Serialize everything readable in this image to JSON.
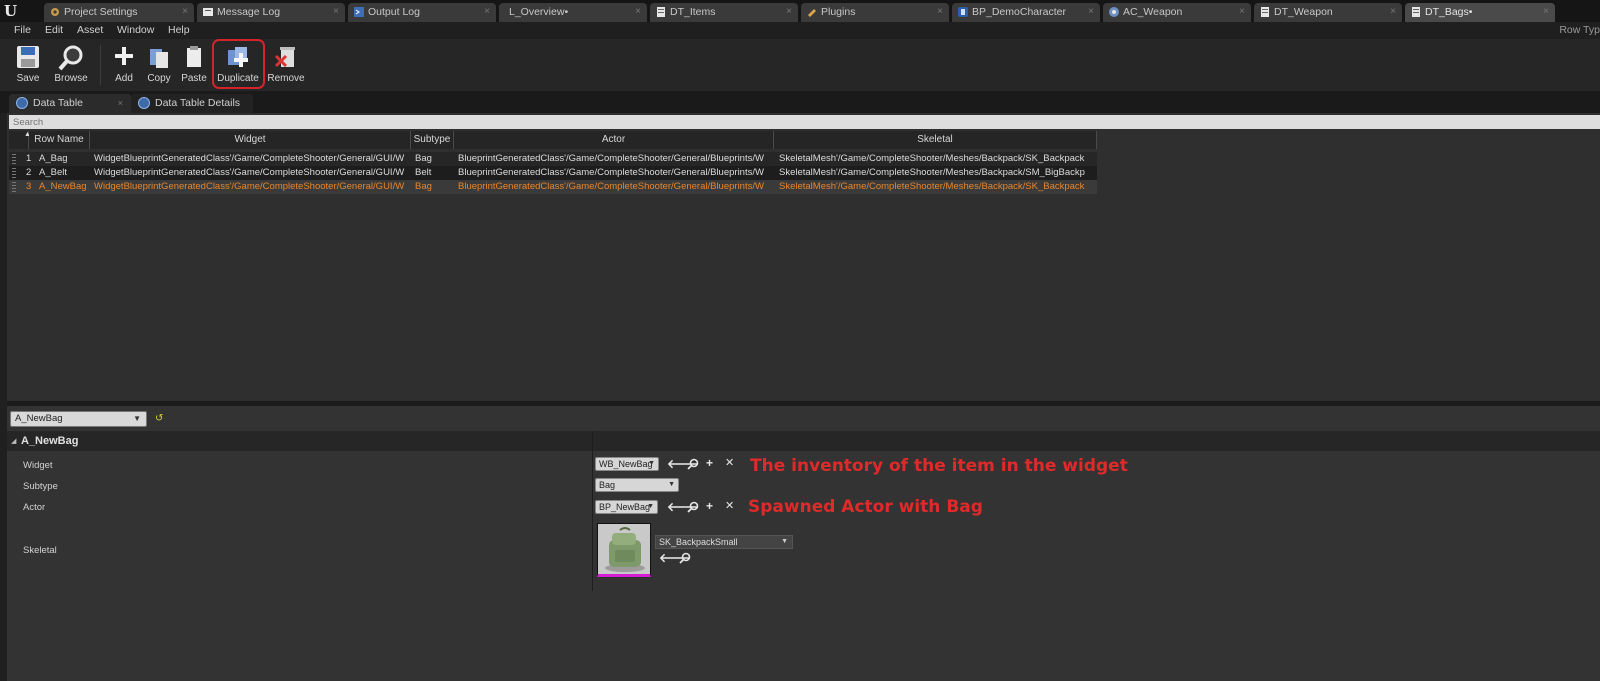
{
  "tabs": [
    {
      "label": "Project Settings",
      "icon": "settings-icon"
    },
    {
      "label": "Message Log",
      "icon": "message-log-icon"
    },
    {
      "label": "Output Log",
      "icon": "output-log-icon"
    },
    {
      "label": "L_Overview•",
      "icon": ""
    },
    {
      "label": "DT_Items",
      "icon": "data-table-icon"
    },
    {
      "label": "Plugins",
      "icon": "plugins-icon"
    },
    {
      "label": "BP_DemoCharacter",
      "icon": "blueprint-icon"
    },
    {
      "label": "AC_Weapon",
      "icon": "actor-component-icon"
    },
    {
      "label": "DT_Weapon",
      "icon": "data-table-icon"
    },
    {
      "label": "DT_Bags•",
      "icon": "data-table-icon"
    }
  ],
  "menu": [
    "File",
    "Edit",
    "Asset",
    "Window",
    "Help"
  ],
  "row_type_label": "Row Typ",
  "toolbar": {
    "save": "Save",
    "browse": "Browse",
    "add": "Add",
    "copy": "Copy",
    "paste": "Paste",
    "duplicate": "Duplicate",
    "remove": "Remove"
  },
  "panel_tabs": [
    "Data Table",
    "Data Table Details"
  ],
  "search": {
    "placeholder": "Search"
  },
  "table": {
    "columns": [
      "Row Name",
      "Widget",
      "Subtype",
      "Actor",
      "Skeletal"
    ],
    "rows": [
      {
        "index": "1",
        "name": "A_Bag",
        "widget": "WidgetBlueprintGeneratedClass'/Game/CompleteShooter/General/GUI/W",
        "subtype": "Bag",
        "actor": "BlueprintGeneratedClass'/Game/CompleteShooter/General/Blueprints/W",
        "skeletal": "SkeletalMesh'/Game/CompleteShooter/Meshes/Backpack/SK_Backpack"
      },
      {
        "index": "2",
        "name": "A_Belt",
        "widget": "WidgetBlueprintGeneratedClass'/Game/CompleteShooter/General/GUI/W",
        "subtype": "Belt",
        "actor": "BlueprintGeneratedClass'/Game/CompleteShooter/General/Blueprints/W",
        "skeletal": "SkeletalMesh'/Game/CompleteShooter/Meshes/Backpack/SM_BigBackp"
      },
      {
        "index": "3",
        "name": "A_NewBag",
        "widget": "WidgetBlueprintGeneratedClass'/Game/CompleteShooter/General/GUI/W",
        "subtype": "Bag",
        "actor": "BlueprintGeneratedClass'/Game/CompleteShooter/General/Blueprints/W",
        "skeletal": "SkeletalMesh'/Game/CompleteShooter/Meshes/Backpack/SK_Backpack"
      }
    ],
    "selected_index": 2,
    "selected_color": "#e8862a"
  },
  "details": {
    "row_select": "A_NewBag",
    "category": "A_NewBag",
    "props": {
      "widget_label": "Widget",
      "widget_value": "WB_NewBag",
      "subtype_label": "Subtype",
      "subtype_value": "Bag",
      "actor_label": "Actor",
      "actor_value": "BP_NewBag",
      "skeletal_label": "Skeletal",
      "skeletal_value": "SK_BackpackSmall"
    }
  },
  "annotations": {
    "widget_note": "The inventory of the item in the widget",
    "actor_note": "Spawned Actor with Bag",
    "color": "#e02a2a"
  },
  "highlight_color": "#d3232b"
}
